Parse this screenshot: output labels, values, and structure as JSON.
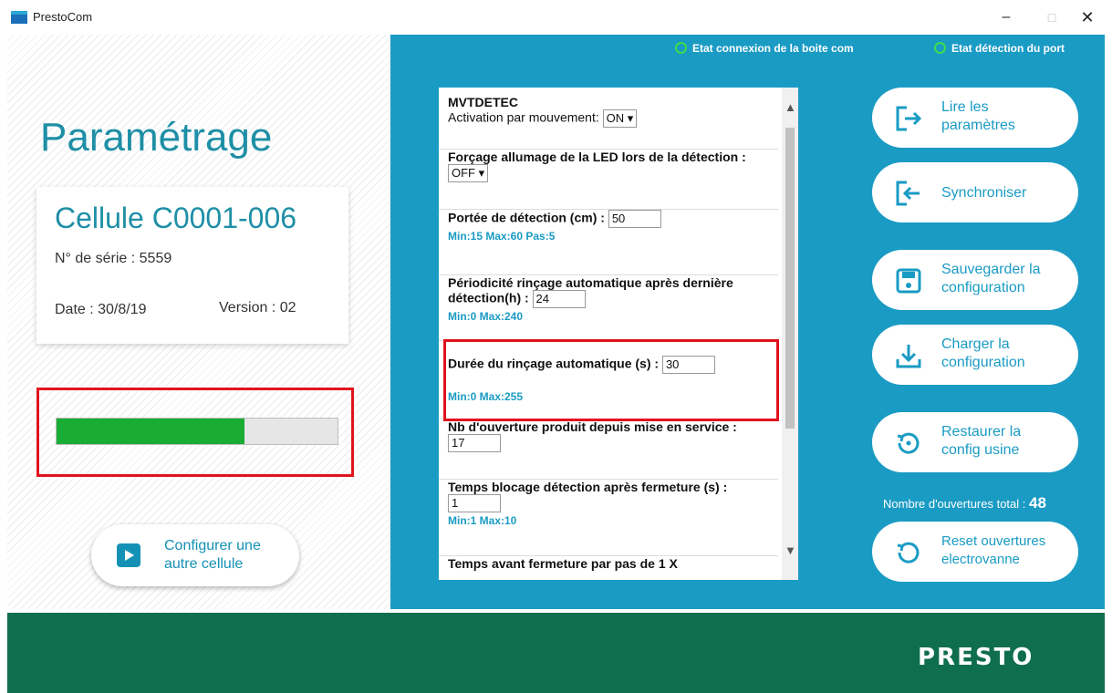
{
  "window": {
    "title": "PrestoCom",
    "minimize": "–",
    "maximize": "□",
    "close": "✕"
  },
  "left": {
    "title": "Paramétrage",
    "cell_name": "Cellule C0001-006",
    "serial": "N° de série : 5559",
    "date": "Date : 30/8/19",
    "version": "Version :  02",
    "progress_fraction": 0.67,
    "configure_label": "Configurer une autre cellule"
  },
  "status": {
    "com": "Etat connexion de la boite com",
    "port": "Etat détection du port"
  },
  "params": {
    "p1_title": "MVTDETEC",
    "p1_label": "Activation par mouvement:",
    "p1_value": "ON",
    "p2_label": "Forçage allumage de la LED lors de la détection :",
    "p2_value": "OFF",
    "p3_label": "Portée de détection (cm) :",
    "p3_value": "50",
    "p3_hint": "Min:15 Max:60 Pas:5",
    "p4_label": "Périodicité rinçage automatique après dernière détection(h) :",
    "p4_value": "24",
    "p4_hint": "Min:0 Max:240",
    "p5_label": "Durée du rinçage automatique (s) :",
    "p5_value": "30",
    "p5_hint": "Min:0 Max:255",
    "p6_label": "Nb d'ouverture produit depuis mise en service :",
    "p6_value": "17",
    "p7_label": "Temps blocage détection après fermeture (s) :",
    "p7_value": "1",
    "p7_hint": "Min:1 Max:10",
    "p8_label": "Temps avant fermeture par pas de 1 X"
  },
  "actions": {
    "read": "Lire les paramètres",
    "sync": "Synchroniser",
    "save": "Sauvegarder la configuration",
    "load": "Charger la configuration",
    "restore": "Restaurer la config usine",
    "reset": "Reset ouvertures electrovanne",
    "total_label": "Nombre d'ouvertures total :",
    "total_value": "48"
  },
  "footer": {
    "logo": "PRESTO"
  },
  "colors": {
    "accent": "#1a9bc4",
    "footer": "#0f6e4e",
    "progress": "#19ad35",
    "highlight": "#e0141e"
  }
}
